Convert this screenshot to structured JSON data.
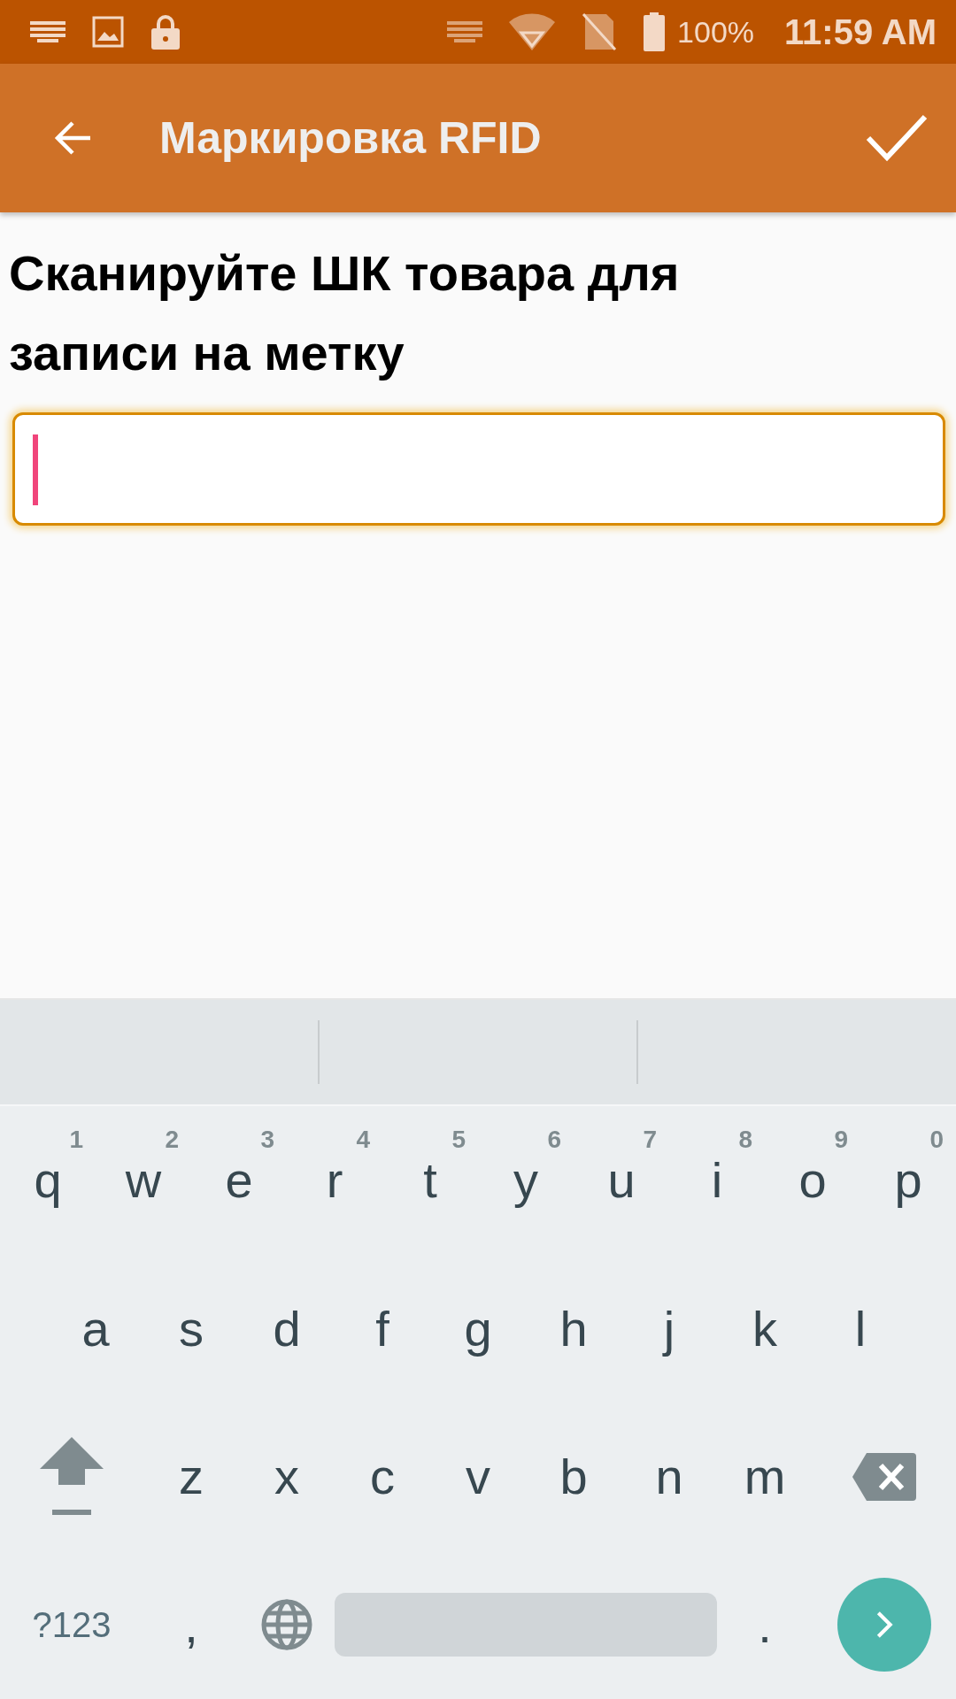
{
  "status_bar": {
    "battery": "100%",
    "time": "11:59 AM"
  },
  "app_bar": {
    "title": "Маркировка RFID"
  },
  "prompt": "Сканируйте ШК товара для записи на метку",
  "barcode_field": {
    "focused": true
  },
  "keyboard": {
    "rows": [
      {
        "keys": [
          {
            "kind": "letter",
            "label": "q",
            "hint": "1"
          },
          {
            "kind": "letter",
            "label": "w",
            "hint": "2"
          },
          {
            "kind": "letter",
            "label": "e",
            "hint": "3"
          },
          {
            "kind": "letter",
            "label": "r",
            "hint": "4"
          },
          {
            "kind": "letter",
            "label": "t",
            "hint": "5"
          },
          {
            "kind": "letter",
            "label": "y",
            "hint": "6"
          },
          {
            "kind": "letter",
            "label": "u",
            "hint": "7"
          },
          {
            "kind": "letter",
            "label": "i",
            "hint": "8"
          },
          {
            "kind": "letter",
            "label": "o",
            "hint": "9"
          },
          {
            "kind": "letter",
            "label": "p",
            "hint": "0"
          }
        ]
      },
      {
        "keys": [
          {
            "kind": "letter",
            "label": "a"
          },
          {
            "kind": "letter",
            "label": "s"
          },
          {
            "kind": "letter",
            "label": "d"
          },
          {
            "kind": "letter",
            "label": "f"
          },
          {
            "kind": "letter",
            "label": "g"
          },
          {
            "kind": "letter",
            "label": "h"
          },
          {
            "kind": "letter",
            "label": "j"
          },
          {
            "kind": "letter",
            "label": "k"
          },
          {
            "kind": "letter",
            "label": "l"
          }
        ]
      },
      {
        "keys": [
          {
            "kind": "shift"
          },
          {
            "kind": "letter",
            "label": "z"
          },
          {
            "kind": "letter",
            "label": "x"
          },
          {
            "kind": "letter",
            "label": "c"
          },
          {
            "kind": "letter",
            "label": "v"
          },
          {
            "kind": "letter",
            "label": "b"
          },
          {
            "kind": "letter",
            "label": "n"
          },
          {
            "kind": "letter",
            "label": "m"
          },
          {
            "kind": "backspace"
          }
        ]
      },
      {
        "keys": [
          {
            "kind": "symbols",
            "label": "?123"
          },
          {
            "kind": "letter",
            "label": ","
          },
          {
            "kind": "globe"
          },
          {
            "kind": "space"
          },
          {
            "kind": "letter",
            "label": "."
          },
          {
            "kind": "enter"
          }
        ]
      }
    ]
  }
}
